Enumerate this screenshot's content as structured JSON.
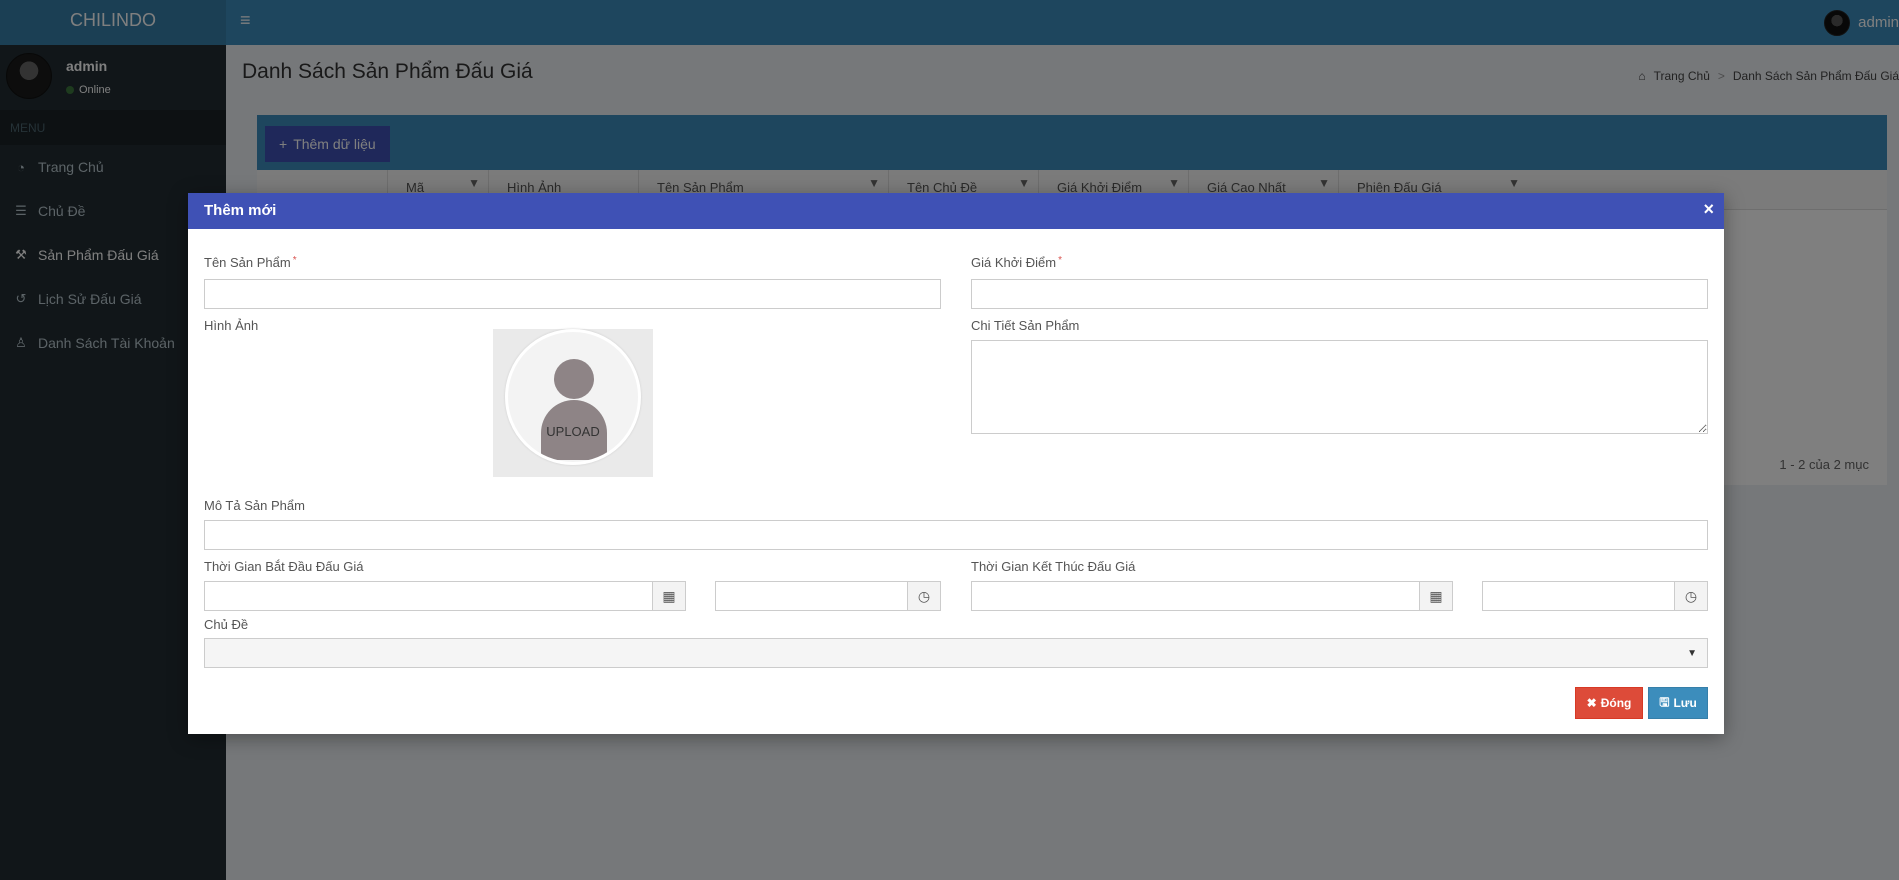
{
  "app": {
    "logo": "CHILINDO",
    "top_user": "admin"
  },
  "sidebar": {
    "user_name": "admin",
    "user_status": "Online",
    "menu_header": "MENU",
    "items": [
      {
        "label": "Trang Chủ",
        "icon": "dashboard-icon"
      },
      {
        "label": "Chủ Đề",
        "icon": "list-icon"
      },
      {
        "label": "Sản Phẩm Đấu Giá",
        "icon": "gavel-icon",
        "active": true
      },
      {
        "label": "Lịch Sử Đấu Giá",
        "icon": "history-icon"
      },
      {
        "label": "Danh Sách Tài Khoản",
        "icon": "user-icon"
      }
    ]
  },
  "page": {
    "title": "Danh Sách Sản Phẩm Đấu Giá",
    "breadcrumb": [
      "Trang Chủ",
      "Danh Sách Sản Phẩm Đấu Giá"
    ],
    "add_button": "Thêm dữ liệu",
    "columns": [
      "Mã",
      "Hình Ảnh",
      "Tên Sản Phẩm",
      "Tên Chủ Đề",
      "Giá Khởi Điểm",
      "Giá Cao Nhất",
      "Phiên Đấu Giá"
    ],
    "pager_info": "1 - 2 của 2 mục"
  },
  "modal": {
    "title": "Thêm mới",
    "close_symbol": "×",
    "fields": {
      "product_name": {
        "label": "Tên Sản Phẩm",
        "required": "*",
        "value": ""
      },
      "start_price": {
        "label": "Giá Khởi Điểm",
        "required": "*",
        "value": ""
      },
      "image": {
        "label": "Hình Ảnh",
        "upload_text": "UPLOAD"
      },
      "detail": {
        "label": "Chi Tiết Sản Phẩm",
        "value": ""
      },
      "description": {
        "label": "Mô Tả Sản Phẩm",
        "value": ""
      },
      "start_time": {
        "label": "Thời Gian Bắt Đầu Đấu Giá",
        "date": "",
        "time": ""
      },
      "end_time": {
        "label": "Thời Gian Kết Thúc Đấu Giá",
        "date": "",
        "time": ""
      },
      "category": {
        "label": "Chủ Đề",
        "value": ""
      }
    },
    "buttons": {
      "close": "Đóng",
      "save": "Lưu"
    }
  }
}
